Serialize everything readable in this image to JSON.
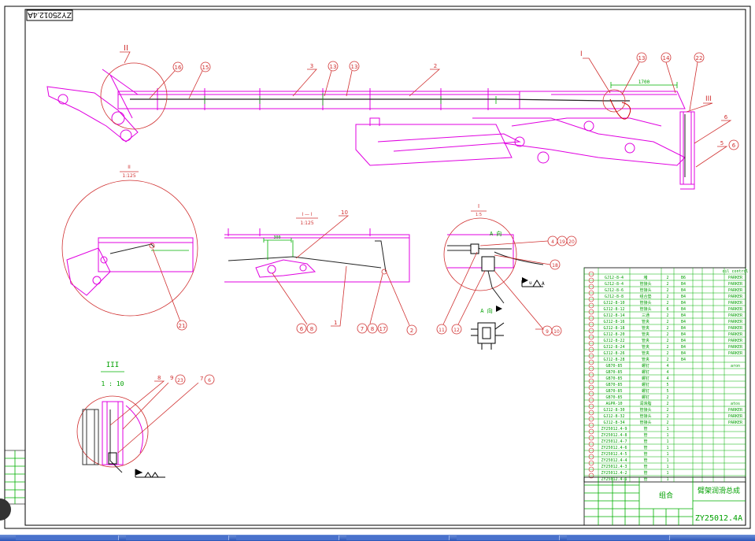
{
  "drawing": {
    "title_upside_down": "ZY25012.4A",
    "number": "ZY25012.4A",
    "name": "臂架润滑总成",
    "material": "组合",
    "scale": "1:10"
  },
  "views": {
    "detail_II": "II",
    "detail_II_scale": "1:125",
    "section_I_I": "I — I",
    "section_I_I_scale": "1:125",
    "detail_I": "I",
    "detail_I_scale": "1:5",
    "view_A": "A 向",
    "detail_III": "III",
    "detail_III_scale": "1 : 10",
    "dimension_main": "1700",
    "dimension_section": "300"
  },
  "callouts": [
    {
      "label": "II"
    },
    {
      "label": "16"
    },
    {
      "label": "15"
    },
    {
      "label": "3"
    },
    {
      "label": "13"
    },
    {
      "label": "13"
    },
    {
      "label": "2"
    },
    {
      "label": "I"
    },
    {
      "label": "13"
    },
    {
      "label": "14"
    },
    {
      "label": "22"
    },
    {
      "label": "III"
    },
    {
      "label": "6"
    },
    {
      "label": "5"
    },
    {
      "label": "6"
    },
    {
      "label": "10"
    },
    {
      "label": "6"
    },
    {
      "label": "8"
    },
    {
      "label": "1"
    },
    {
      "label": "7"
    },
    {
      "label": "8"
    },
    {
      "label": "17"
    },
    {
      "label": "21"
    },
    {
      "label": "4"
    },
    {
      "label": "19"
    },
    {
      "label": "20"
    },
    {
      "label": "18"
    },
    {
      "label": "9"
    },
    {
      "label": "10"
    },
    {
      "label": "11"
    },
    {
      "label": "12"
    },
    {
      "label": "8"
    },
    {
      "label": "9"
    },
    {
      "label": "23"
    },
    {
      "label": "7"
    },
    {
      "label": "6"
    }
  ],
  "bom": {
    "rows": [
      {
        "code": "GJ12-8-4",
        "name": "堵",
        "qty": "2",
        "spec": "B6",
        "mat": "PARKER"
      },
      {
        "code": "GJ12-8-4",
        "name": "管接头",
        "qty": "2",
        "spec": "B4",
        "mat": "PARKER"
      },
      {
        "code": "GJ12-8-6",
        "name": "管接头",
        "qty": "2",
        "spec": "B4",
        "mat": "PARKER"
      },
      {
        "code": "GJ12-8-8",
        "name": "组合垫",
        "qty": "2",
        "spec": "B4",
        "mat": "PARKER"
      },
      {
        "code": "GJ12-8-10",
        "name": "管接头",
        "qty": "2",
        "spec": "B4",
        "mat": "PARKER"
      },
      {
        "code": "GJ12-8-12",
        "name": "管接头",
        "qty": "6",
        "spec": "B4",
        "mat": "PARKER"
      },
      {
        "code": "GJ12-8-14",
        "name": "三通",
        "qty": "2",
        "spec": "B4",
        "mat": "PARKER"
      },
      {
        "code": "GJ12-8-16",
        "name": "管夹",
        "qty": "2",
        "spec": "B4",
        "mat": "PARKER"
      },
      {
        "code": "GJ12-8-18",
        "name": "管夹",
        "qty": "2",
        "spec": "B4",
        "mat": "PARKER"
      },
      {
        "code": "GJ12-8-20",
        "name": "管夹",
        "qty": "2",
        "spec": "B4",
        "mat": "PARKER"
      },
      {
        "code": "GJ12-8-22",
        "name": "管夹",
        "qty": "2",
        "spec": "B4",
        "mat": "PARKER"
      },
      {
        "code": "GJ12-8-24",
        "name": "管夹",
        "qty": "2",
        "spec": "B4",
        "mat": "PARKER"
      },
      {
        "code": "GJ12-8-26",
        "name": "管夹",
        "qty": "2",
        "spec": "B4",
        "mat": "PARKER"
      },
      {
        "code": "GJ12-8-28",
        "name": "管夹",
        "qty": "2",
        "spec": "B4",
        "mat": ""
      },
      {
        "code": "GB70-85",
        "name": "螺钉",
        "qty": "4",
        "spec": "",
        "mat": "aron"
      },
      {
        "code": "GB70-85",
        "name": "螺钉",
        "qty": "4",
        "spec": "",
        "mat": ""
      },
      {
        "code": "GB70-85",
        "name": "螺钉",
        "qty": "4",
        "spec": "",
        "mat": ""
      },
      {
        "code": "GB70-85",
        "name": "螺钉",
        "qty": "5",
        "spec": "",
        "mat": ""
      },
      {
        "code": "GB70-85",
        "name": "螺钉",
        "qty": "5",
        "spec": "",
        "mat": ""
      },
      {
        "code": "GB70-85",
        "name": "螺钉",
        "qty": "2",
        "spec": "",
        "mat": ""
      },
      {
        "code": "AGPR-10",
        "name": "润滑脂",
        "qty": "2",
        "spec": "",
        "mat": "atos"
      },
      {
        "code": "GJ12-8-30",
        "name": "管接头",
        "qty": "2",
        "spec": "",
        "mat": "PARKER"
      },
      {
        "code": "GJ12-8-32",
        "name": "管接头",
        "qty": "2",
        "spec": "",
        "mat": "PARKER"
      },
      {
        "code": "GJ12-8-34",
        "name": "管接头",
        "qty": "2",
        "spec": "",
        "mat": "PARKER"
      },
      {
        "code": "ZY25012.4-9",
        "name": "管",
        "qty": "1",
        "spec": "",
        "mat": ""
      },
      {
        "code": "ZY25012.4-8",
        "name": "管",
        "qty": "1",
        "spec": "",
        "mat": ""
      },
      {
        "code": "ZY25012.4-7",
        "name": "管",
        "qty": "1",
        "spec": "",
        "mat": ""
      },
      {
        "code": "ZY25012.4-6",
        "name": "管",
        "qty": "1",
        "spec": "",
        "mat": ""
      },
      {
        "code": "ZY25012.4-5",
        "name": "管",
        "qty": "1",
        "spec": "",
        "mat": ""
      },
      {
        "code": "ZY25012.4-4",
        "name": "管",
        "qty": "1",
        "spec": "",
        "mat": ""
      },
      {
        "code": "ZY25012.4-3",
        "name": "管",
        "qty": "1",
        "spec": "",
        "mat": ""
      },
      {
        "code": "ZY25012.4-2",
        "name": "管",
        "qty": "1",
        "spec": "",
        "mat": ""
      },
      {
        "code": "ZY25012.4-1",
        "name": "管",
        "qty": "1",
        "spec": "",
        "mat": ""
      }
    ],
    "header_label": "oil control"
  },
  "colors": {
    "structure": "#e000e0",
    "hose": "#00b000",
    "callout": "#d03030",
    "taskbar": "#2b55b8"
  }
}
